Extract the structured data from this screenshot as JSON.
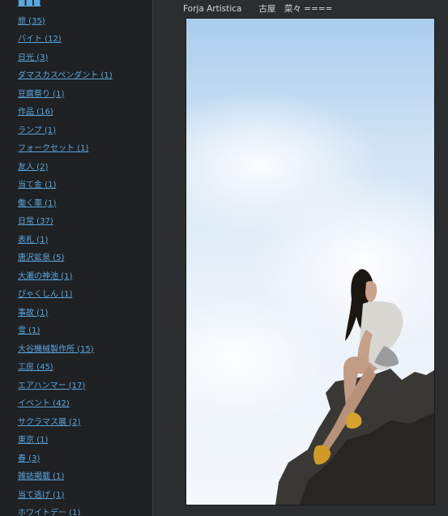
{
  "sidebar": {
    "categories": [
      {
        "label": "■■■"
      },
      {
        "label": "旅 (35)"
      },
      {
        "label": "バイト (12)"
      },
      {
        "label": "日光 (3)"
      },
      {
        "label": "ダマスカスペンダント (1)"
      },
      {
        "label": "豆腐祭り (1)"
      },
      {
        "label": "作品 (16)"
      },
      {
        "label": "ランプ (1)"
      },
      {
        "label": "フォークセット (1)"
      },
      {
        "label": "友人 (2)"
      },
      {
        "label": "当て金 (1)"
      },
      {
        "label": "働く車 (1)"
      },
      {
        "label": "日常 (37)"
      },
      {
        "label": "表札 (1)"
      },
      {
        "label": "唐沢鉱泉 (5)"
      },
      {
        "label": "大瀬の神池 (1)"
      },
      {
        "label": "ぴゃくしん (1)"
      },
      {
        "label": "事故 (1)"
      },
      {
        "label": "雪 (1)"
      },
      {
        "label": "大谷機械製作所 (15)"
      },
      {
        "label": "工房 (45)"
      },
      {
        "label": "エアハンマー (17)"
      },
      {
        "label": "イベント (42)"
      },
      {
        "label": "サクラマス展 (2)"
      },
      {
        "label": "東京 (1)"
      },
      {
        "label": "春 (3)"
      },
      {
        "label": "雑誌掲載 (1)"
      },
      {
        "label": "当て逃げ (1)"
      },
      {
        "label": "ホワイトデー (1)"
      }
    ]
  },
  "main": {
    "caption": "Forja Artistica　　古屋　菜々 ===="
  },
  "colors": {
    "sidebar_bg": "#1f2123",
    "main_bg": "#2b2d2f",
    "link": "#5aa7e0",
    "caption_text": "#d8d8d8"
  }
}
